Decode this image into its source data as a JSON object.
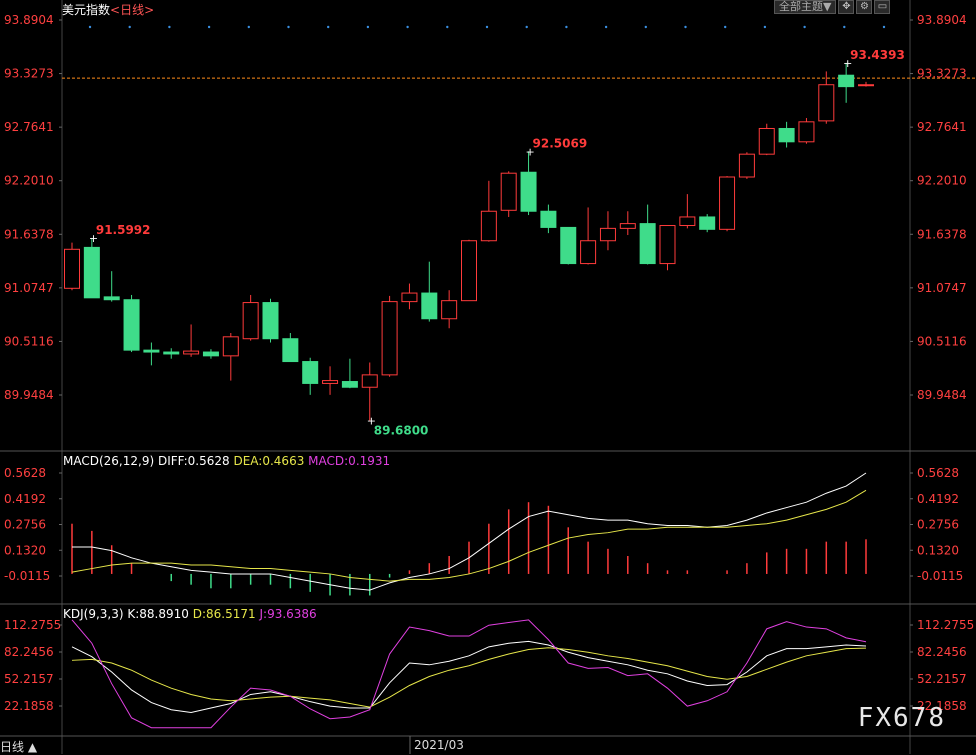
{
  "header": {
    "symbol": "美元指数",
    "period": "<日线>"
  },
  "toolbar": {
    "theme_label": "全部主题▼"
  },
  "bottom": {
    "period_label": "日线 ▲",
    "date_label": "2021/03"
  },
  "watermark": "FX678",
  "colors": {
    "up": "#ff3b3b",
    "down": "#3fdc8a",
    "diff": "#ffffff",
    "dea": "#e6e64a",
    "k": "#ffffff",
    "d": "#e6e64a",
    "j": "#e040e0",
    "axis_text": "#ff4040",
    "ref_line": "#ff8c1a"
  },
  "chart_data": [
    {
      "type": "candlestick",
      "title": "美元指数<日线>",
      "ylim": [
        89.6,
        93.95
      ],
      "y_ticks": [
        "93.8904",
        "93.3273",
        "92.7641",
        "92.2010",
        "91.6378",
        "91.0747",
        "90.5116",
        "89.9484"
      ],
      "ref_line": 93.28,
      "annotations": [
        {
          "label": "91.5992",
          "value": 91.5992,
          "candle": 1
        },
        {
          "label": "92.5069",
          "value": 92.5069,
          "candle": 23
        },
        {
          "label": "89.6800",
          "value": 89.68,
          "candle": 15
        },
        {
          "label": "93.4393",
          "value": 93.4393,
          "candle": 39
        }
      ],
      "candles": [
        {
          "o": 91.07,
          "h": 91.55,
          "l": 91.05,
          "c": 91.48
        },
        {
          "o": 91.5,
          "h": 91.6,
          "l": 90.98,
          "c": 90.97
        },
        {
          "o": 90.98,
          "h": 91.25,
          "l": 90.93,
          "c": 90.95
        },
        {
          "o": 90.95,
          "h": 91.0,
          "l": 90.4,
          "c": 90.42
        },
        {
          "o": 90.42,
          "h": 90.5,
          "l": 90.26,
          "c": 90.4
        },
        {
          "o": 90.4,
          "h": 90.44,
          "l": 90.33,
          "c": 90.38
        },
        {
          "o": 90.38,
          "h": 90.69,
          "l": 90.35,
          "c": 90.41
        },
        {
          "o": 90.4,
          "h": 90.43,
          "l": 90.33,
          "c": 90.36
        },
        {
          "o": 90.36,
          "h": 90.6,
          "l": 90.1,
          "c": 90.56
        },
        {
          "o": 90.54,
          "h": 91.0,
          "l": 90.52,
          "c": 90.92
        },
        {
          "o": 90.92,
          "h": 90.96,
          "l": 90.5,
          "c": 90.54
        },
        {
          "o": 90.54,
          "h": 90.6,
          "l": 90.3,
          "c": 90.3
        },
        {
          "o": 90.3,
          "h": 90.34,
          "l": 89.95,
          "c": 90.07
        },
        {
          "o": 90.07,
          "h": 90.25,
          "l": 89.95,
          "c": 90.1
        },
        {
          "o": 90.09,
          "h": 90.33,
          "l": 90.02,
          "c": 90.03
        },
        {
          "o": 90.03,
          "h": 90.29,
          "l": 89.68,
          "c": 90.16
        },
        {
          "o": 90.16,
          "h": 90.99,
          "l": 90.14,
          "c": 90.93
        },
        {
          "o": 90.93,
          "h": 91.12,
          "l": 90.85,
          "c": 91.02
        },
        {
          "o": 91.02,
          "h": 91.35,
          "l": 90.72,
          "c": 90.75
        },
        {
          "o": 90.75,
          "h": 91.05,
          "l": 90.65,
          "c": 90.94
        },
        {
          "o": 90.94,
          "h": 91.58,
          "l": 90.94,
          "c": 91.57
        },
        {
          "o": 91.57,
          "h": 92.2,
          "l": 91.56,
          "c": 91.88
        },
        {
          "o": 91.89,
          "h": 92.3,
          "l": 91.82,
          "c": 92.28
        },
        {
          "o": 92.29,
          "h": 92.51,
          "l": 91.84,
          "c": 91.88
        },
        {
          "o": 91.88,
          "h": 91.95,
          "l": 91.65,
          "c": 91.71
        },
        {
          "o": 91.71,
          "h": 91.71,
          "l": 91.32,
          "c": 91.33
        },
        {
          "o": 91.33,
          "h": 91.92,
          "l": 91.32,
          "c": 91.57
        },
        {
          "o": 91.57,
          "h": 91.88,
          "l": 91.47,
          "c": 91.7
        },
        {
          "o": 91.7,
          "h": 91.88,
          "l": 91.63,
          "c": 91.75
        },
        {
          "o": 91.75,
          "h": 91.95,
          "l": 91.32,
          "c": 91.33
        },
        {
          "o": 91.33,
          "h": 91.71,
          "l": 91.26,
          "c": 91.73
        },
        {
          "o": 91.73,
          "h": 92.06,
          "l": 91.7,
          "c": 91.82
        },
        {
          "o": 91.82,
          "h": 91.85,
          "l": 91.66,
          "c": 91.69
        },
        {
          "o": 91.69,
          "h": 92.25,
          "l": 91.67,
          "c": 92.24
        },
        {
          "o": 92.24,
          "h": 92.5,
          "l": 92.22,
          "c": 92.48
        },
        {
          "o": 92.48,
          "h": 92.8,
          "l": 92.47,
          "c": 92.75
        },
        {
          "o": 92.75,
          "h": 92.82,
          "l": 92.55,
          "c": 92.61
        },
        {
          "o": 92.61,
          "h": 92.86,
          "l": 92.59,
          "c": 92.82
        },
        {
          "o": 92.83,
          "h": 93.35,
          "l": 92.8,
          "c": 93.21
        },
        {
          "o": 93.31,
          "h": 93.44,
          "l": 93.02,
          "c": 93.19
        },
        {
          "o": 93.2,
          "h": 93.24,
          "l": 93.19,
          "c": 93.21
        }
      ]
    },
    {
      "type": "line",
      "title": "MACD(26,12,9)",
      "labels": {
        "diff": "DIFF:0.5628",
        "dea": "DEA:0.4663",
        "macd": "MACD:0.1931"
      },
      "ylim": [
        -0.13,
        0.6
      ],
      "y_ticks": [
        "0.5628",
        "0.4192",
        "0.2756",
        "0.1320",
        "-0.0115"
      ],
      "series": [
        {
          "name": "DIFF",
          "values": [
            0.15,
            0.15,
            0.13,
            0.09,
            0.06,
            0.04,
            0.02,
            0.01,
            0.0,
            0.0,
            0.0,
            -0.02,
            -0.04,
            -0.06,
            -0.08,
            -0.09,
            -0.05,
            -0.02,
            0.0,
            0.03,
            0.09,
            0.17,
            0.25,
            0.32,
            0.35,
            0.33,
            0.31,
            0.3,
            0.3,
            0.28,
            0.27,
            0.27,
            0.26,
            0.27,
            0.3,
            0.34,
            0.37,
            0.4,
            0.45,
            0.49,
            0.5628
          ]
        },
        {
          "name": "DEA",
          "values": [
            0.01,
            0.03,
            0.05,
            0.06,
            0.06,
            0.06,
            0.05,
            0.05,
            0.04,
            0.03,
            0.03,
            0.02,
            0.01,
            0.0,
            -0.02,
            -0.03,
            -0.04,
            -0.03,
            -0.03,
            -0.02,
            0.0,
            0.03,
            0.07,
            0.12,
            0.16,
            0.2,
            0.22,
            0.23,
            0.25,
            0.25,
            0.26,
            0.26,
            0.26,
            0.26,
            0.27,
            0.28,
            0.3,
            0.33,
            0.36,
            0.4,
            0.4663
          ]
        },
        {
          "name": "MACD",
          "values": [
            0.28,
            0.24,
            0.16,
            0.06,
            0.0,
            -0.04,
            -0.06,
            -0.08,
            -0.08,
            -0.06,
            -0.06,
            -0.08,
            -0.1,
            -0.12,
            -0.12,
            -0.12,
            -0.02,
            0.02,
            0.06,
            0.1,
            0.18,
            0.28,
            0.36,
            0.4,
            0.38,
            0.26,
            0.18,
            0.14,
            0.1,
            0.06,
            0.02,
            0.02,
            0.0,
            0.02,
            0.06,
            0.12,
            0.14,
            0.14,
            0.18,
            0.18,
            0.1931
          ]
        }
      ]
    },
    {
      "type": "line",
      "title": "KDJ(9,3,3)",
      "labels": {
        "k": "K:88.8910",
        "d": "D:86.5171",
        "j": "J:93.6386"
      },
      "ylim": [
        -2,
        117
      ],
      "y_ticks": [
        "112.2755",
        "82.2456",
        "52.2157",
        "22.1858"
      ],
      "series": [
        {
          "name": "K",
          "values": [
            88,
            77,
            60,
            40,
            26,
            18,
            15,
            20,
            25,
            35,
            38,
            33,
            27,
            22,
            20,
            20,
            48,
            70,
            68,
            72,
            78,
            88,
            92,
            94,
            90,
            82,
            76,
            72,
            68,
            62,
            58,
            50,
            45,
            46,
            60,
            78,
            86,
            86,
            88,
            90,
            88.891
          ]
        },
        {
          "name": "D",
          "values": [
            73,
            74,
            70,
            62,
            51,
            42,
            35,
            30,
            28,
            30,
            32,
            33,
            31,
            29,
            25,
            21,
            32,
            45,
            55,
            62,
            67,
            74,
            80,
            85,
            87,
            85,
            82,
            78,
            75,
            71,
            67,
            61,
            55,
            52,
            55,
            63,
            71,
            78,
            82,
            86,
            86.5171
          ]
        },
        {
          "name": "J",
          "values": [
            118,
            92,
            47,
            9,
            -2,
            -2,
            -2,
            -2,
            21,
            42,
            40,
            33,
            19,
            8,
            10,
            18,
            80,
            110,
            106,
            100,
            100,
            112,
            115,
            118,
            96,
            70,
            64,
            65,
            56,
            58,
            42,
            22,
            28,
            38,
            70,
            108,
            116,
            110,
            108,
            98,
            93.6386
          ]
        }
      ]
    }
  ]
}
